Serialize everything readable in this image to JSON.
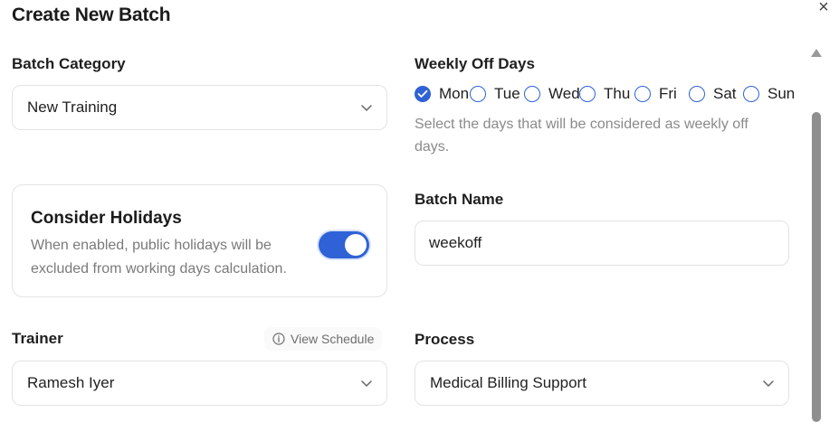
{
  "dialog": {
    "title": "Create New Batch",
    "close_icon": "×"
  },
  "batch_category": {
    "label": "Batch Category",
    "value": "New Training"
  },
  "weekly_off": {
    "label": "Weekly Off Days",
    "days": [
      {
        "label": "Mon",
        "checked": true
      },
      {
        "label": "Tue",
        "checked": false
      },
      {
        "label": "Wed",
        "checked": false
      },
      {
        "label": "Thu",
        "checked": false
      },
      {
        "label": "Fri",
        "checked": false
      },
      {
        "label": "Sat",
        "checked": false
      },
      {
        "label": "Sun",
        "checked": false
      }
    ],
    "help_line1": "Select the days that will be considered as weekly off",
    "help_line2": "days."
  },
  "holidays": {
    "title": "Consider Holidays",
    "description": "When enabled, public holidays will be excluded from working days calculation.",
    "enabled": true
  },
  "batch_name": {
    "label": "Batch Name",
    "value": "weekoff"
  },
  "trainer": {
    "label": "Trainer",
    "view_schedule": "View Schedule",
    "value": "Ramesh Iyer"
  },
  "process": {
    "label": "Process",
    "value": "Medical Billing Support"
  },
  "colors": {
    "accent": "#2f62d6",
    "border": "#e3e3e3",
    "muted_text": "#7a7a7a"
  }
}
